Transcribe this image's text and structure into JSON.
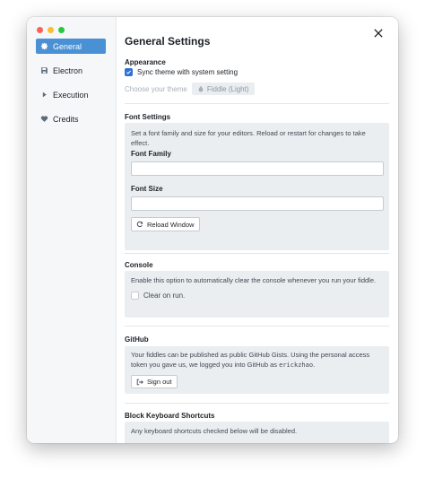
{
  "sidebar": {
    "items": [
      {
        "label": "General",
        "icon": "gear-icon"
      },
      {
        "label": "Electron",
        "icon": "floppy-icon"
      },
      {
        "label": "Execution",
        "icon": "play-icon"
      },
      {
        "label": "Credits",
        "icon": "heart-icon"
      }
    ]
  },
  "header": {
    "title": "General Settings"
  },
  "appearance": {
    "title": "Appearance",
    "sync_label": "Sync theme with system setting",
    "choose_label": "Choose your theme",
    "theme_value": "Fiddle (Light)"
  },
  "font": {
    "title": "Font Settings",
    "description": "Set a font family and size for your editors. Reload or restart for changes to take effect.",
    "family_label": "Font Family",
    "size_label": "Font Size",
    "reload_label": "Reload Window"
  },
  "console": {
    "title": "Console",
    "description": "Enable this option to automatically clear the console whenever you run your fiddle.",
    "clear_label": "Clear on run."
  },
  "github": {
    "title": "GitHub",
    "description": "Your fiddles can be published as public GitHub Gists. Using the personal access token you gave us, we logged you into GitHub as",
    "username": "erickzhao",
    "period": ".",
    "signout_label": "Sign out"
  },
  "shortcuts": {
    "title": "Block Keyboard Shortcuts",
    "description": "Any keyboard shortcuts checked below will be disabled."
  },
  "colors": {
    "accent": "#4a90d4",
    "checkbox": "#2d72d2",
    "panel": "#ebeef1"
  }
}
